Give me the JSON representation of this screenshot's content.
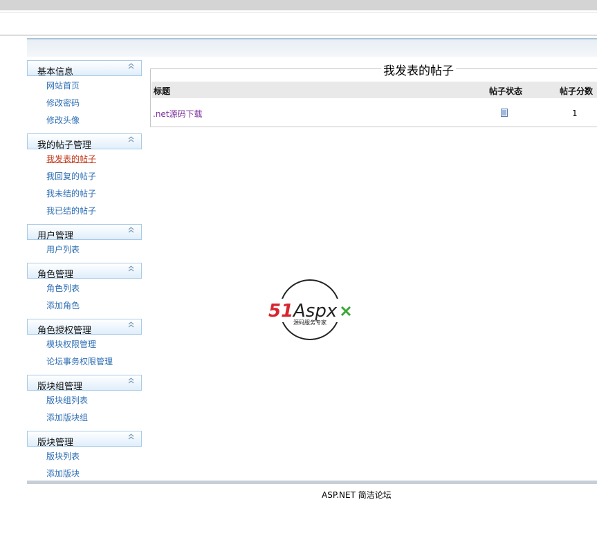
{
  "sidebar": {
    "groups": [
      {
        "title": "基本信息",
        "items": [
          "网站首页",
          "修改密码",
          "修改头像"
        ]
      },
      {
        "title": "我的帖子管理",
        "items": [
          "我发表的帖子",
          "我回复的帖子",
          "我未结的帖子",
          "我已结的帖子"
        ]
      },
      {
        "title": "用户管理",
        "items": [
          "用户列表"
        ]
      },
      {
        "title": "角色管理",
        "items": [
          "角色列表",
          "添加角色"
        ]
      },
      {
        "title": "角色授权管理",
        "items": [
          "模块权限管理",
          "论坛事务权限管理"
        ]
      },
      {
        "title": "版块组管理",
        "items": [
          "版块组列表",
          "添加版块组"
        ]
      },
      {
        "title": "版块管理",
        "items": [
          "版块列表",
          "添加版块"
        ]
      }
    ],
    "active_item": "我发表的帖子"
  },
  "main": {
    "title": "我发表的帖子",
    "columns": [
      "标题",
      "帖子状态",
      "帖子分数"
    ],
    "rows": [
      {
        "title": ".net源码下载",
        "status_icon": "document-icon",
        "score": "1"
      }
    ]
  },
  "logo": {
    "brand_left": "51",
    "brand_right": "Aspx",
    "tagline": "源码服务专家"
  },
  "footer": {
    "text": "ASP.NET 简洁论坛"
  },
  "colors": {
    "link": "#2f6fb5",
    "active_link": "#c23b1e",
    "visited_link": "#7c2f9e",
    "logo_red": "#d8262e",
    "logo_green": "#3aa635"
  }
}
